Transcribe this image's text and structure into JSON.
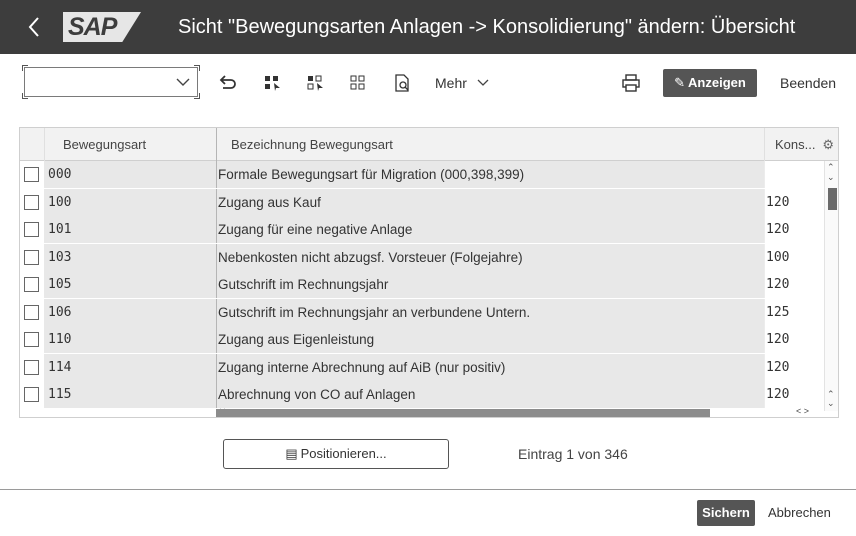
{
  "header": {
    "back_icon": "chevron-left-icon",
    "logo_text": "SAP",
    "title": "Sicht \"Bewegungsarten Anlagen -> Konsolidierung\" ändern: Übersicht"
  },
  "toolbar": {
    "command_field_value": "",
    "more_label": "Mehr",
    "display_label": "Anzeigen",
    "exit_label": "Beenden",
    "icons": [
      "undo-icon",
      "select-all-icon",
      "select-block-icon",
      "deselect-all-icon",
      "where-used-icon",
      "print-icon"
    ]
  },
  "table": {
    "columns": {
      "selection": "",
      "code": "Bewegungsart",
      "description": "Bezeichnung Bewegungsart",
      "konsolidierung": "Kons..."
    },
    "rows": [
      {
        "code": "000",
        "description": "Formale Bewegungsart für Migration (000,398,399)",
        "kons": ""
      },
      {
        "code": "100",
        "description": "Zugang aus Kauf",
        "kons": "120"
      },
      {
        "code": "101",
        "description": "Zugang für eine negative Anlage",
        "kons": "120"
      },
      {
        "code": "103",
        "description": "Nebenkosten nicht abzugsf. Vorsteuer (Folgejahre)",
        "kons": "100"
      },
      {
        "code": "105",
        "description": "Gutschrift im Rechnungsjahr",
        "kons": "120"
      },
      {
        "code": "106",
        "description": "Gutschrift im Rechnungsjahr an verbundene Untern.",
        "kons": "125"
      },
      {
        "code": "110",
        "description": "Zugang aus Eigenleistung",
        "kons": "120"
      },
      {
        "code": "114",
        "description": "Zugang interne Abrechnung auf AiB (nur positiv)",
        "kons": "120"
      },
      {
        "code": "115",
        "description": "Abrechnung von CO auf Anlagen",
        "kons": "120"
      }
    ]
  },
  "position": {
    "button_label": "Positionieren...",
    "entry_text": "Eintrag 1 von 346"
  },
  "footer": {
    "save_label": "Sichern",
    "cancel_label": "Abbrechen"
  },
  "colors": {
    "header_bg": "#3d3d3d",
    "primary_button": "#555555",
    "readonly_cell_bg": "#e8e8e8"
  }
}
